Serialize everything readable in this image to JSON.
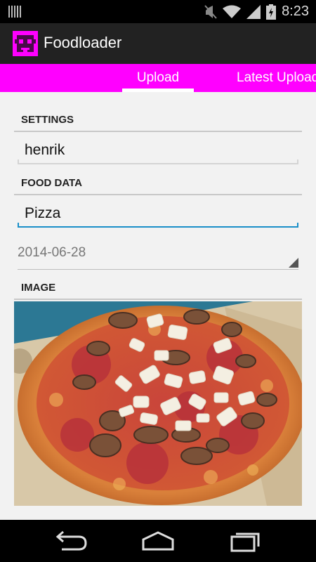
{
  "status_bar": {
    "time": "8:23",
    "icons": [
      "notification-bars-icon",
      "mute-icon",
      "wifi-icon",
      "signal-icon",
      "battery-icon"
    ]
  },
  "app": {
    "title": "Foodloader",
    "icon": "space-invader-icon"
  },
  "tabs": [
    {
      "label": "Upload",
      "selected": true
    },
    {
      "label": "Latest Uploads",
      "selected": false
    }
  ],
  "sections": {
    "settings": "SETTINGS",
    "food_data": "FOOD DATA",
    "image": "IMAGE"
  },
  "fields": {
    "username": "henrik",
    "food_name": "Pizza",
    "date": "2014-06-28"
  },
  "nav_bar": {
    "icons": [
      "back-icon",
      "home-icon",
      "recent-apps-icon"
    ]
  },
  "colors": {
    "accent": "#ff00ff",
    "action_bar": "#222222",
    "focus_underline": "#1a8fc9",
    "background": "#f2f2f2"
  }
}
